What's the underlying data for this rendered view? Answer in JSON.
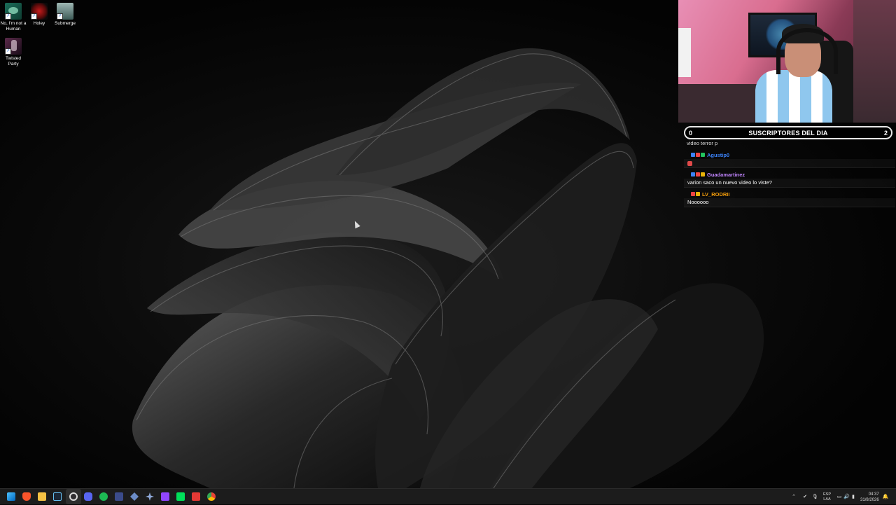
{
  "desktop": {
    "icons": [
      {
        "label": "No, I'm not a Human",
        "name": "desktop-icon-no-im-not-a-human"
      },
      {
        "label": "Holey",
        "name": "desktop-icon-holey"
      },
      {
        "label": "Submerge",
        "name": "desktop-icon-submerge"
      },
      {
        "label": "Twisted Party",
        "name": "desktop-icon-twisted-party"
      }
    ]
  },
  "overlay": {
    "subs_left": "0",
    "subs_title": "SUSCRIPTORES DEL DIA",
    "subs_right": "2"
  },
  "chat": {
    "clipped_text": "video terror p",
    "messages": [
      {
        "user": "Agustip0",
        "user_color": "#3b82f6",
        "text": ""
      },
      {
        "user": "Guadamartinez",
        "user_color": "#c084fc",
        "text": "varion saco un nuevo video lo viste?"
      },
      {
        "user": "LV_RODRII",
        "user_color": "#f59e0b",
        "text": "Noooooo"
      }
    ]
  },
  "taskbar": {
    "apps": [
      "start-icon",
      "brave-icon",
      "file-explorer-icon",
      "steam-icon",
      "obs-icon",
      "discord-icon",
      "spotify-icon",
      "app-window-icon",
      "vpn-icon",
      "controller-icon",
      "twitch-icon",
      "game-icon",
      "media-icon",
      "chrome-icon"
    ],
    "tray": {
      "lang_line1": "ESP",
      "lang_line2": "LAA",
      "time": "04:37",
      "date": "31/8/2026"
    }
  },
  "colors": {
    "taskbar_bg": "#1c1c1c",
    "sub_bar_border": "#e6e6e6"
  }
}
